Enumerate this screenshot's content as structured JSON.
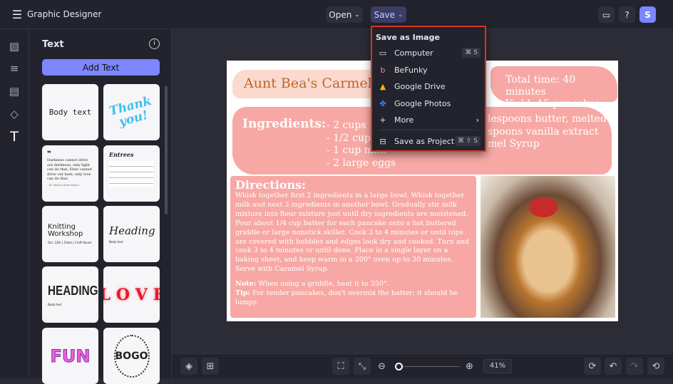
{
  "app": {
    "title": "Graphic Designer",
    "open_label": "Open",
    "save_label": "Save",
    "avatar": "S"
  },
  "panel": {
    "title": "Text",
    "add_text": "Add Text",
    "templates": [
      "Body text",
      "Thank you!",
      "Darkness cannot drive out darkness; only light can do that. Hate cannot drive out hate; only love can do that.",
      "Entrees",
      "Knitting Workshop",
      "Heading",
      "HEADING",
      "LOVE",
      "FUN",
      "BOGO"
    ],
    "template_subtext": {
      "quote_author": "– Dr. Martin Luther King Jr.",
      "knitting_date": "Oct. 12th | 10am | Craft House",
      "heading_body": "Body text",
      "heading2_body": "Body text"
    }
  },
  "menu": {
    "section": "Save as Image",
    "items": [
      {
        "label": "Computer",
        "icon": "monitor-icon",
        "shortcut": "⌘ S"
      },
      {
        "label": "BeFunky",
        "icon": "befunky-icon"
      },
      {
        "label": "Google Drive",
        "icon": "google-drive-icon"
      },
      {
        "label": "Google Photos",
        "icon": "google-photos-icon"
      },
      {
        "label": "More",
        "icon": "plus-icon"
      },
      {
        "label": "Save as Project",
        "icon": "briefcase-icon",
        "shortcut": "⌘ ⇧ S"
      }
    ]
  },
  "recipe": {
    "title": "Aunt Bea's Carmel C",
    "time": "Total time: 40 minutes",
    "yield": "Yield: 15 pancakes",
    "ingredients_label": "Ingredients:",
    "ingredients_left": [
      "- 2 cups",
      "- 1/2 cup",
      "- 1 cup milk",
      "- 2 large eggs"
    ],
    "ingredients_right": [
      "lespoons butter, melted",
      "spoons vanilla extract",
      "mel Syrup"
    ],
    "directions_label": "Directions:",
    "directions": "Whisk together first 2 ingredients in a large bowl. Whisk together milk and next 3 ingredients in another bowl. Gradually stir milk mixture into flour mixture just until dry ingredients are moistened. Pour about 1/4 cup batter for each pancake onto a hot buttered griddle or large nonstick skillet. Cook 3 to 4 minutes or until tops are covered with bubbles and edges look dry and cooked. Turn and cook 3 to 4 minutes or until done. Place in a single layer on a baking sheet, and keep warm in a 200° oven up to 30 minutes. Serve with Caramel Syrup.",
    "note_label": "Note:",
    "note": " When using a griddle, heat it to 350°.",
    "tip_label": "Tip:",
    "tip": " For tender pancakes, don't overmix the batter; it should be lumpy."
  },
  "zoom": {
    "label": "41%",
    "value": 41
  },
  "colors": {
    "accent": "#7b86ff",
    "menu_border": "#e0321f",
    "pink": "#f7a8a4",
    "title_orange": "#c0652a"
  }
}
